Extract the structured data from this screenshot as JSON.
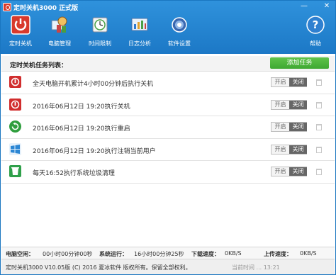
{
  "window": {
    "title": "定时关机3000 正式版",
    "min_glyph": "—",
    "close_glyph": "✕"
  },
  "toolbar": {
    "items": [
      {
        "label": "定时关机",
        "icon": "power-icon"
      },
      {
        "label": "电脑管理",
        "icon": "computer-management-icon"
      },
      {
        "label": "时间限制",
        "icon": "clock-icon"
      },
      {
        "label": "日志分析",
        "icon": "log-analysis-icon"
      },
      {
        "label": "软件设置",
        "icon": "gear-icon"
      },
      {
        "label": "帮助",
        "icon": "help-icon"
      }
    ]
  },
  "task_list": {
    "title": "定时关机任务列表：",
    "add_button": "添加任务",
    "toggle_on_label": "开启",
    "toggle_off_label": "关闭",
    "tasks": [
      {
        "text": "全天电脑开机累计4小时00分钟后执行关机",
        "icon": "shutdown-icon",
        "color": "#d12d2d"
      },
      {
        "text": "2016年06月12日 19:20执行关机",
        "icon": "shutdown-icon",
        "color": "#d12d2d"
      },
      {
        "text": "2016年06月12日 19:20执行重启",
        "icon": "restart-icon",
        "color": "#2f9e3e"
      },
      {
        "text": "2016年06月12日 19:20执行注销当前用户",
        "icon": "windows-icon",
        "color": "#2b86d4"
      },
      {
        "text": "每天16:52执行系统垃圾清理",
        "icon": "trash-clean-icon",
        "color": "#2fa04a"
      }
    ]
  },
  "status": {
    "boot_time_label": "电脑空闲：",
    "boot_time_value": "00小时00分钟00秒",
    "system_run_label": "系统运行：",
    "system_run_value": "16小时00分钟25秒",
    "download_label": "下载速度：",
    "download_value": "0KB/S",
    "upload_label": "上传速度：",
    "upload_value": "0KB/S"
  },
  "footer": {
    "copyright": "定时关机3000 V10.05版 (C) 2016  夏冰软件 版权所有。保留全部权利。",
    "watermark": "当前时间 ... 13:21"
  }
}
